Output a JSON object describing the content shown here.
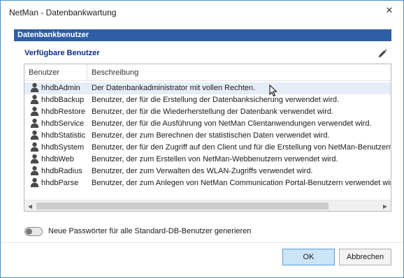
{
  "window": {
    "title": "NetMan - Datenbankwartung",
    "close_glyph": "✕"
  },
  "section_header": "Datenbankbenutzer",
  "group": {
    "label": "Verfügbare Benutzer",
    "edit_icon": "pencil-icon"
  },
  "list": {
    "columns": [
      "Benutzer",
      "Beschreibung"
    ],
    "row_icon": "user-icon",
    "selected_index": 0,
    "rows": [
      {
        "name": "hhdbAdmin",
        "desc": "Der Datenbankadministrator mit vollen Rechten."
      },
      {
        "name": "hhdbBackup",
        "desc": "Benutzer, der für die Erstellung der Datenbanksicherung verwendet wird."
      },
      {
        "name": "hhdbRestore",
        "desc": "Benutzer, der für die Wiederherstellung der Datenbank verwendet wird."
      },
      {
        "name": "hhdbService",
        "desc": "Benutzer, der für die Ausführung von NetMan Clientanwendungen verwendet wird."
      },
      {
        "name": "hhdbStatistic",
        "desc": "Benutzer, der zum Berechnen der statistischen Daten verwendet wird."
      },
      {
        "name": "hhdbSystem",
        "desc": "Benutzer, der für den Zugriff auf den Client und für die Erstellung von NetMan-Benutzern"
      },
      {
        "name": "hhdbWeb",
        "desc": "Benutzer, der zum Erstellen von NetMan-Webbenutzern verwendet wird."
      },
      {
        "name": "hhdbRadius",
        "desc": "Benutzer, der zum Verwalten des WLAN-Zugriffs verwendet wird."
      },
      {
        "name": "hhdbParse",
        "desc": "Benutzer, der zum Anlegen von NetMan Communication Portal-Benutzern verwendet wird"
      }
    ],
    "scroll_left_glyph": "◀",
    "scroll_right_glyph": "▶"
  },
  "toggle": {
    "label": "Neue Passwörter für alle Standard-DB-Benutzer generieren",
    "on": false
  },
  "buttons": {
    "ok": "OK",
    "cancel": "Abbrechen"
  },
  "colors": {
    "header_bg": "#2e5fa6",
    "group_label": "#0a2e8a",
    "selected_row": "#e5eef8",
    "ok_bg": "#cce4f7",
    "ok_border": "#5a9bd5"
  }
}
